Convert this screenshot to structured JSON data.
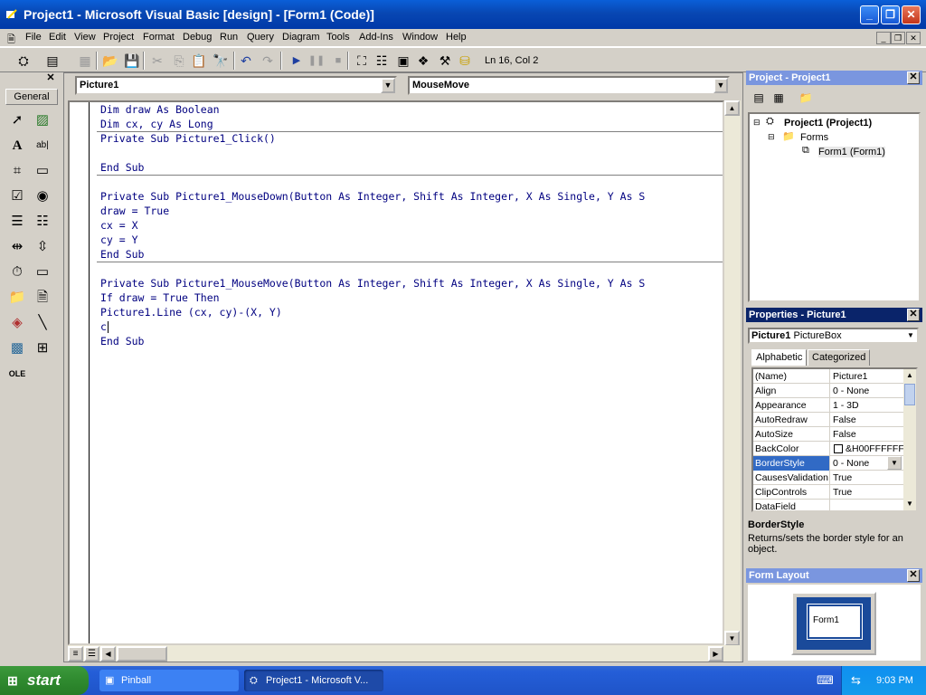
{
  "window": {
    "title": "Project1 - Microsoft Visual Basic [design] - [Form1 (Code)]"
  },
  "menu": [
    "File",
    "Edit",
    "View",
    "Project",
    "Format",
    "Debug",
    "Run",
    "Query",
    "Diagram",
    "Tools",
    "Add-Ins",
    "Window",
    "Help"
  ],
  "toolbar": {
    "status": "Ln 16, Col 2"
  },
  "toolbox": {
    "tab_label": "General"
  },
  "code": {
    "object_combo": "Picture1",
    "procedure_combo": "MouseMove",
    "lines": [
      "Dim draw As Boolean",
      "Dim cx, cy As Long",
      "Private Sub Picture1_Click()",
      "",
      "End Sub",
      "",
      "Private Sub Picture1_MouseDown(Button As Integer, Shift As Integer, X As Single, Y As S",
      "draw = True",
      "cx = X",
      "cy = Y",
      "End Sub",
      "",
      "Private Sub Picture1_MouseMove(Button As Integer, Shift As Integer, X As Single, Y As S",
      "If draw = True Then",
      "Picture1.Line (cx, cy)-(X, Y)",
      "c",
      "End Sub"
    ]
  },
  "project": {
    "title": "Project - Project1",
    "root": "Project1 (Project1)",
    "folder": "Forms",
    "item": "Form1 (Form1)"
  },
  "properties": {
    "title": "Properties - Picture1",
    "object_name": "Picture1",
    "object_type": "PictureBox",
    "tabs": [
      "Alphabetic",
      "Categorized"
    ],
    "rows": [
      {
        "name": "(Name)",
        "value": "Picture1"
      },
      {
        "name": "Align",
        "value": "0 - None"
      },
      {
        "name": "Appearance",
        "value": "1 - 3D"
      },
      {
        "name": "AutoRedraw",
        "value": "False"
      },
      {
        "name": "AutoSize",
        "value": "False"
      },
      {
        "name": "BackColor",
        "value": "&H00FFFFFF"
      },
      {
        "name": "BorderStyle",
        "value": "0 - None"
      },
      {
        "name": "CausesValidation",
        "value": "True"
      },
      {
        "name": "ClipControls",
        "value": "True"
      },
      {
        "name": "DataField",
        "value": ""
      }
    ],
    "desc_title": "BorderStyle",
    "desc_text": "Returns/sets the border style for an object."
  },
  "form_layout": {
    "title": "Form Layout",
    "form_label": "Form1"
  },
  "taskbar": {
    "start": "start",
    "tasks": [
      "Pinball",
      "Project1 - Microsoft V..."
    ],
    "clock": "9:03 PM"
  },
  "colors": {
    "title_active": "#0a246a",
    "title_inactive": "#7a96df",
    "code_text": "#000080",
    "selection": "#316ac5"
  }
}
